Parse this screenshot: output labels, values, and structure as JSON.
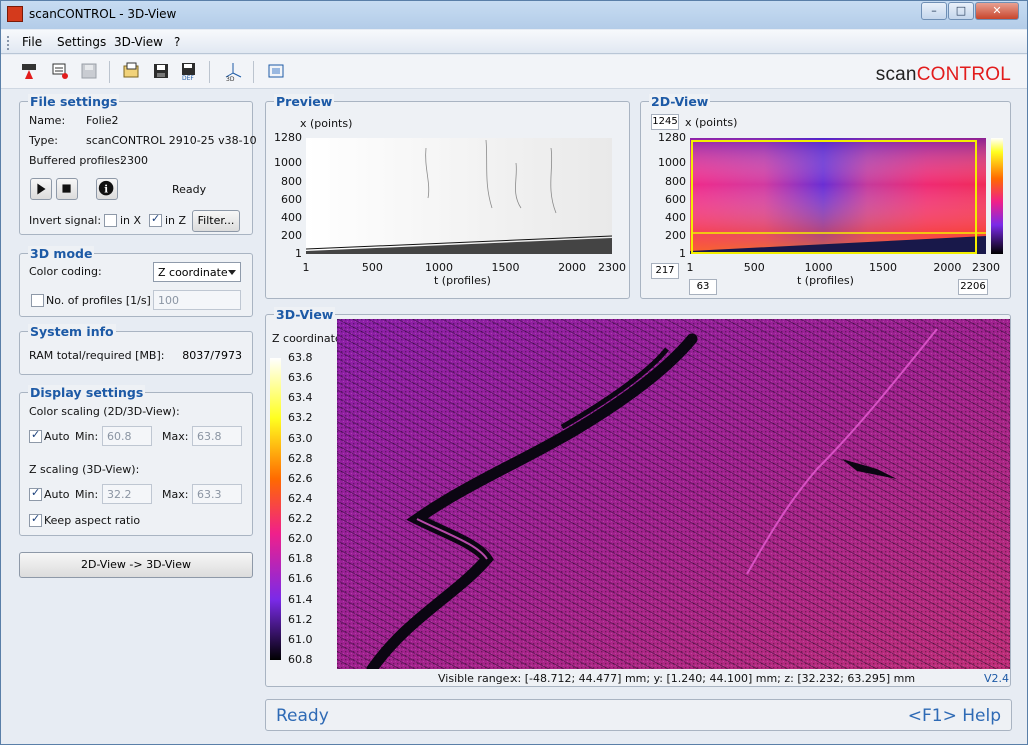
{
  "window": {
    "title": "scanCONTROL - 3D-View"
  },
  "menu": [
    {
      "label": "File"
    },
    {
      "label": "Settings"
    },
    {
      "label": "3D-View"
    },
    {
      "label": "?"
    }
  ],
  "toolbar": {
    "icons": [
      "laser-icon",
      "scanner-settings-icon",
      "save-disabled-icon",
      "open-folder-icon",
      "save-icon",
      "save-default-icon",
      "3d-axis-icon",
      "fit-view-icon"
    ]
  },
  "logo": {
    "part1": "scan",
    "part2": "CONTROL"
  },
  "file_settings": {
    "title": "File settings",
    "name_label": "Name:",
    "name_value": "Folie2",
    "type_label": "Type:",
    "type_value": "scanCONTROL 2910-25 v38-10",
    "buffered_label": "Buffered profiles:",
    "buffered_value": "2300",
    "status": "Ready",
    "invert_label": "Invert signal:",
    "invert_x_label": "in X",
    "invert_x_checked": false,
    "invert_z_label": "in Z",
    "invert_z_checked": true,
    "filter_button": "Filter..."
  },
  "mode_3d": {
    "title": "3D mode",
    "color_coding_label": "Color coding:",
    "color_coding_value": "Z coordinate",
    "profiles_label": "No. of profiles [1/s]",
    "profiles_checked": false,
    "profiles_value": "100"
  },
  "system_info": {
    "title": "System info",
    "ram_label": "RAM total/required [MB]:",
    "ram_value": "8037/7973"
  },
  "display_settings": {
    "title": "Display settings",
    "color_scaling_label": "Color scaling (2D/3D-View):",
    "color_auto_label": "Auto",
    "color_auto_checked": true,
    "color_min_label": "Min:",
    "color_min": "60.8",
    "color_max_label": "Max:",
    "color_max": "63.8",
    "z_scaling_label": "Z scaling (3D-View):",
    "z_auto_label": "Auto",
    "z_auto_checked": true,
    "z_min_label": "Min:",
    "z_min": "32.2",
    "z_max_label": "Max:",
    "z_max": "63.3",
    "keep_aspect_label": "Keep aspect ratio",
    "keep_aspect_checked": true
  },
  "view_button": "2D-View -> 3D-View",
  "preview": {
    "title": "Preview",
    "y_axis_title": "x (points)",
    "y_ticks": [
      "1280",
      "1000",
      "800",
      "600",
      "400",
      "200",
      "1"
    ],
    "x_ticks": [
      "1",
      "500",
      "1000",
      "1500",
      "2000",
      "2300"
    ],
    "x_axis_title": "t (profiles)"
  },
  "view_2d": {
    "title": "2D-View",
    "y_axis_title": "x (points)",
    "box_top": "1245",
    "box_left": "217",
    "box_bottom_left": "63",
    "box_bottom_right": "2206",
    "y_ticks": [
      "1280",
      "1000",
      "800",
      "600",
      "400",
      "200",
      "1"
    ],
    "x_ticks": [
      "1",
      "500",
      "1000",
      "1500",
      "2000",
      "2300"
    ],
    "x_axis_title": "t (profiles)"
  },
  "view_3d": {
    "title": "3D-View",
    "colorbar_title": "Z coordinate",
    "colorbar_ticks": [
      "63.8",
      "63.6",
      "63.4",
      "63.2",
      "63.0",
      "62.8",
      "62.6",
      "62.4",
      "62.2",
      "62.0",
      "61.8",
      "61.6",
      "61.4",
      "61.2",
      "61.0",
      "60.8"
    ],
    "visible_range_label": "Visible range:",
    "visible_range_value": "x: [-48.712; 44.477] mm; y: [1.240; 44.100] mm; z: [32.232; 63.295] mm",
    "version": "V2.4"
  },
  "status_bar": {
    "status": "Ready",
    "help": "<F1> Help"
  }
}
